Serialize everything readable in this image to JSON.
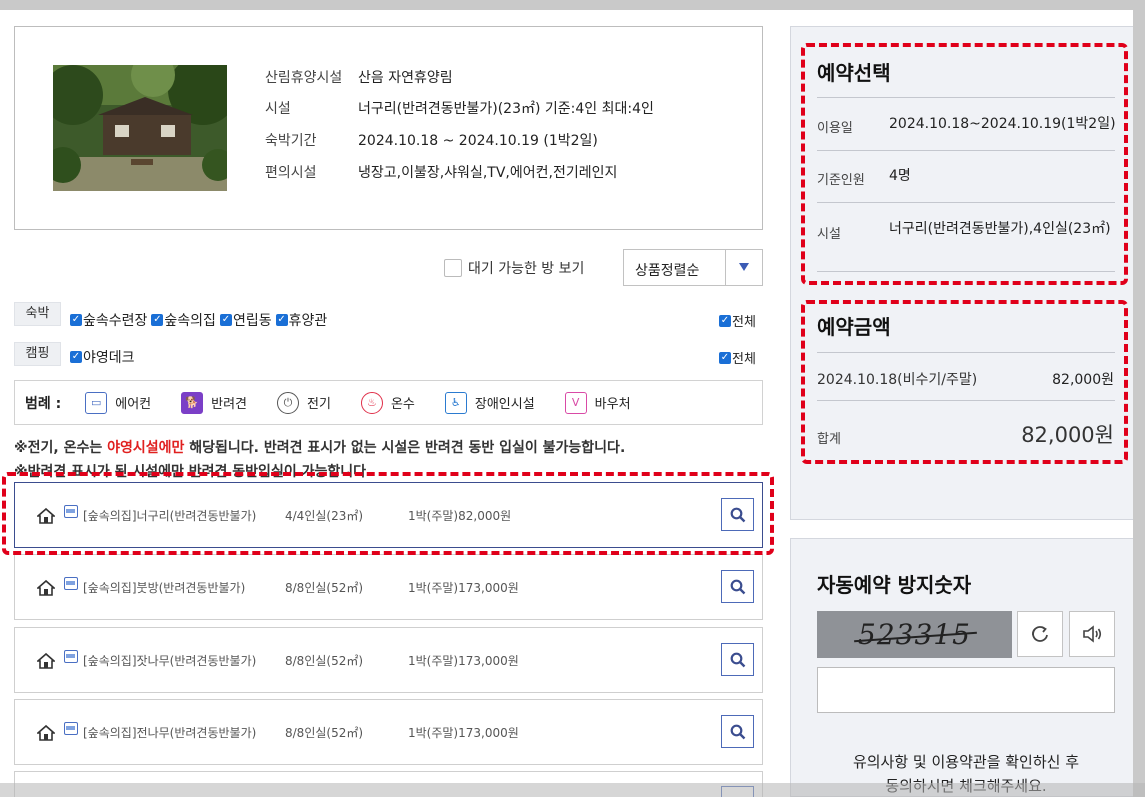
{
  "facility": {
    "rows": [
      {
        "label": "산림휴양시설",
        "value": "산음 자연휴양림"
      },
      {
        "label": "시설",
        "value": "너구리(반려견동반불가)(23㎡) 기준:4인 최대:4인"
      },
      {
        "label": "숙박기간",
        "value": "2024.10.18 ~ 2024.10.19 (1박2일)"
      },
      {
        "label": "편의시설",
        "value": "냉장고,이불장,샤워실,TV,에어컨,전기레인지"
      }
    ]
  },
  "filters": {
    "wait_label": "대기 가능한 방 보기",
    "sort_label": "상품정렬순",
    "all_label": "전체",
    "groups": [
      {
        "tag": "숙박",
        "items": [
          "숲속수련장",
          "숲속의집",
          "연립동",
          "휴양관"
        ]
      },
      {
        "tag": "캠핑",
        "items": [
          "야영데크"
        ]
      }
    ]
  },
  "legend": {
    "title": "범례 :",
    "items": [
      {
        "label": "에어컨",
        "icon": "air-conditioner-icon",
        "color": "#4a6fc3"
      },
      {
        "label": "반려견",
        "icon": "dog-icon",
        "color": "#7b3fc7"
      },
      {
        "label": "전기",
        "icon": "plug-icon",
        "color": "#555555"
      },
      {
        "label": "온수",
        "icon": "hot-water-icon",
        "color": "#e0304a"
      },
      {
        "label": "장애인시설",
        "icon": "wheelchair-icon",
        "color": "#2b7bd0"
      },
      {
        "label": "바우처",
        "icon": "voucher-icon",
        "color": "#d94aa6"
      }
    ]
  },
  "notes": {
    "line1_a": "※전기, 온수는 ",
    "line1_red": "야영시설에만",
    "line1_b": " 해당됩니다. 반려견 표시가 없는 시설은 반려견 동반 입실이 불가능합니다.",
    "line2": "※반려견 표시가 된 시설에만 반려견 동반입실이 가능합니다."
  },
  "rooms": [
    {
      "name": "[숲속의집]너구리(반려견동반불가)",
      "capacity": "4/4인실(23㎡)",
      "price": "1박(주말)82,000원"
    },
    {
      "name": "[숲속의집]붓방(반려견동반불가)",
      "capacity": "8/8인실(52㎡)",
      "price": "1박(주말)173,000원"
    },
    {
      "name": "[숲속의집]잣나무(반려견동반불가)",
      "capacity": "8/8인실(52㎡)",
      "price": "1박(주말)173,000원"
    },
    {
      "name": "[숲속의집]전나무(반려견동반불가)",
      "capacity": "8/8인실(52㎡)",
      "price": "1박(주말)173,000원"
    }
  ],
  "reservation": {
    "title": "예약선택",
    "rows": [
      {
        "label": "이용일",
        "value": "2024.10.18~2024.10.19(1박2일)"
      },
      {
        "label": "기준인원",
        "value": "4명"
      },
      {
        "label": "시설",
        "value": "너구리(반려견동반불가),4인실(23㎡)"
      }
    ]
  },
  "payment": {
    "title": "예약금액",
    "line_label": "2024.10.18(비수기/주말)",
    "line_amount": "82,000원",
    "total_label": "합계",
    "total_amount": "82,000원"
  },
  "captcha": {
    "title": "자동예약 방지숫자",
    "code": "523315",
    "notice_line1": "유의사항 및 이용약관을 확인하신 후",
    "notice_line2": "동의하시면 체크해주세요."
  },
  "colors": {
    "accent": "#3b5bb5",
    "highlight": "#e0001a",
    "warning": "#e0201f"
  }
}
